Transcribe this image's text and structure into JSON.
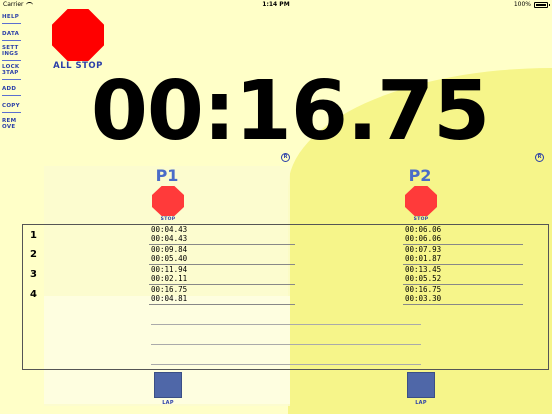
{
  "status": {
    "carrier": "Carrier",
    "time": "1:14 PM",
    "battery": "100%"
  },
  "menu": {
    "items": [
      "HELP",
      "DATA",
      "SETT INGS",
      "LOCK 3TAP",
      "ADD",
      "COPY",
      "REM OVE"
    ]
  },
  "all_stop": {
    "label": "ALL STOP"
  },
  "main_time": "00:16.75",
  "reg_symbol": "R",
  "players": [
    {
      "name": "P1",
      "stop_label": "STOP",
      "lap_label": "LAP"
    },
    {
      "name": "P2",
      "stop_label": "STOP",
      "lap_label": "LAP"
    }
  ],
  "laps": [
    {
      "number": "1",
      "p1_total": "00:04.43",
      "p1_lap": "00:04.43",
      "p2_total": "00:06.06",
      "p2_lap": "00:06.06"
    },
    {
      "number": "2",
      "p1_total": "00:09.84",
      "p1_lap": "00:05.40",
      "p2_total": "00:07.93",
      "p2_lap": "00:01.87"
    },
    {
      "number": "3",
      "p1_total": "00:11.94",
      "p1_lap": "00:02.11",
      "p2_total": "00:13.45",
      "p2_lap": "00:05.52"
    },
    {
      "number": "4",
      "p1_total": "00:16.75",
      "p1_lap": "00:04.81",
      "p2_total": "00:16.75",
      "p2_lap": "00:03.30"
    }
  ],
  "colors": {
    "background": "#ffffc8",
    "accent": "#2b3fa8",
    "stop_red": "#ff0000",
    "player_title": "#4a6cc8",
    "lap_button": "#4f67a8"
  }
}
